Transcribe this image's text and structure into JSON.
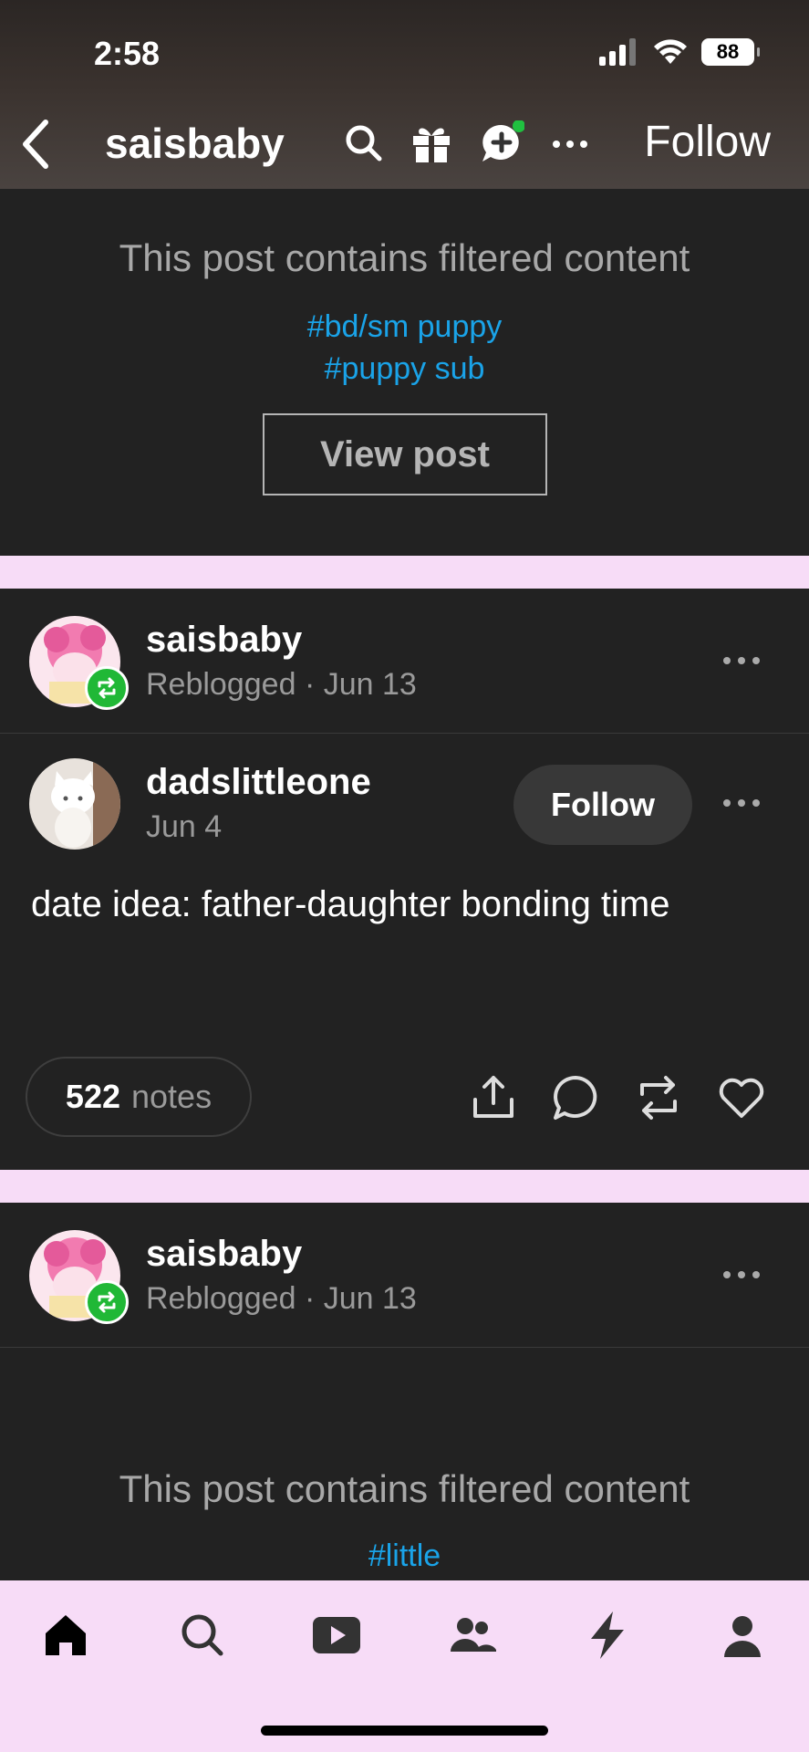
{
  "status_bar": {
    "time": "2:58",
    "battery": "88"
  },
  "header": {
    "blog_name": "saisbaby",
    "follow_label": "Follow"
  },
  "filtered_post_1": {
    "message": "This post contains filtered content",
    "tags": [
      "#bd/sm puppy",
      "#puppy sub"
    ],
    "view_button": "View post"
  },
  "post_2": {
    "reblogger": {
      "name": "saisbaby",
      "action": "Reblogged",
      "date": "Jun 13"
    },
    "author": {
      "name": "dadslittleone",
      "date": "Jun 4",
      "follow_label": "Follow"
    },
    "body": "date idea: father-daughter bonding time",
    "notes_count": "522",
    "notes_label": "notes"
  },
  "post_3": {
    "reblogger": {
      "name": "saisbaby",
      "action": "Reblogged",
      "date": "Jun 13"
    },
    "message": "This post contains filtered content",
    "tags": [
      "#little"
    ]
  },
  "separator": "·",
  "bottom_nav": [
    "home-icon",
    "search-icon",
    "video-icon",
    "people-icon",
    "activity-icon",
    "account-icon"
  ],
  "colors": {
    "accent_blue": "#1aa3e8",
    "reblog_green": "#20b836",
    "card_bg": "#222222",
    "page_pink": "#f7dcf7"
  }
}
